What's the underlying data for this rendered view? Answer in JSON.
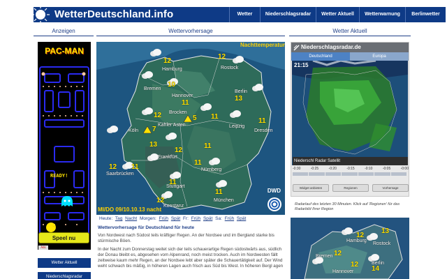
{
  "header": {
    "logo": "WetterDeutschland.info",
    "nav": [
      "Wetter",
      "Niederschlagsradar",
      "Wetter Aktuell",
      "Wetterwarnung",
      "Berlinwetter"
    ]
  },
  "columns": {
    "left": "Anzeigen",
    "middle": "Wettervorhersage",
    "right": "Wetter Aktuell"
  },
  "ads": {
    "game_title": "PAC-MAN",
    "ready": "READY!",
    "cta": "Speel nu",
    "badge": "Ads"
  },
  "left_menu": [
    "Wetter Aktuell",
    "Niederschlagsradar"
  ],
  "forecast_map": {
    "label": "Nachttemperatur",
    "timestamp": "MI/DO 09/10.10.13 nacht",
    "source": "DWD",
    "cities": [
      {
        "name": "Hamburg",
        "temp": "12"
      },
      {
        "name": "Rostock",
        "temp": "12"
      },
      {
        "name": "Bremen",
        "temp": "10"
      },
      {
        "name": "Hannover",
        "temp": "11"
      },
      {
        "name": "Berlin",
        "temp": "13"
      },
      {
        "name": "Brocken",
        "temp": "5"
      },
      {
        "name": "Köln",
        "temp": "7"
      },
      {
        "name": "Kahler Asten",
        "temp": "12"
      },
      {
        "name": "Leipzig",
        "temp": "11"
      },
      {
        "name": "Dresden",
        "temp": "11"
      },
      {
        "name": "Frankfurt",
        "temp": "13"
      },
      {
        "name": "Saarbrücken",
        "temp": "12"
      },
      {
        "name": "Nürnberg",
        "temp": "11"
      },
      {
        "name": "Stuttgart",
        "temp": "11"
      },
      {
        "name": "München",
        "temp": "11"
      },
      {
        "name": "Konstanz",
        "temp": "12"
      }
    ],
    "extra_temps": [
      "11",
      "11",
      "12"
    ]
  },
  "timebar": {
    "today_label": "Heute:",
    "today": [
      "Tag",
      "Nacht"
    ],
    "tomorrow_label": "Morgen:",
    "tomorrow": [
      "Früh",
      "Spät"
    ],
    "fr_label": "Fr:",
    "fr": [
      "Früh",
      "Spät"
    ],
    "sa_label": "Sa:",
    "sa": [
      "Früh",
      "Spät"
    ]
  },
  "article": {
    "title": "Wettervorhersage für Deutschland für heute",
    "p1": "Von Nordwest nach Südost teils kräftiger Regen. An der Nordsee und im Bergland starke bis stürmische Böen.",
    "p2": "In der Nacht zum Donnerstag weitet sich der teils schauerartige Regen südostwärts aus, südlich der Donau bleibt es, abgesehen vom Alpenrand, noch meist trocken. Auch im Nordwesten fällt zeitweise kaum mehr Regen, an der Nordsee lebt aber später die Schauertätigkeit auf. Der Wind weht schwach bis mäßig, in höheren Lagen auch frisch aus Süd bis West. In höheren Bergl agen"
  },
  "radar": {
    "title": "Niederschlagsradar.de",
    "tabs": [
      "Deutschland",
      "Europa"
    ],
    "time": "21:15",
    "strip": "Niederschl   Radar   Satellit",
    "times": [
      "-0:30",
      "-0:25",
      "-0:20",
      "-0:15",
      "-0:10",
      "-0:05",
      "-0:00"
    ],
    "buttons": [
      "Widget anbieten",
      "Regionen",
      "Vorhersage"
    ],
    "note": "Radarlauf des letzten 30 Minuten. Klick auf 'Regionen' für das Radarbild Ihrer Region"
  },
  "mini_map": {
    "cities": [
      {
        "name": "Hamburg",
        "temp": "12"
      },
      {
        "name": "Rostock",
        "temp": "13"
      },
      {
        "name": "Bremen",
        "temp": "12"
      },
      {
        "name": "Berlin",
        "temp": "14"
      },
      {
        "name": "Hannover",
        "temp": "12"
      }
    ]
  },
  "colors": {
    "brand": "#0e3a86",
    "temp": "#ffe100",
    "map": "#1b4d78"
  }
}
